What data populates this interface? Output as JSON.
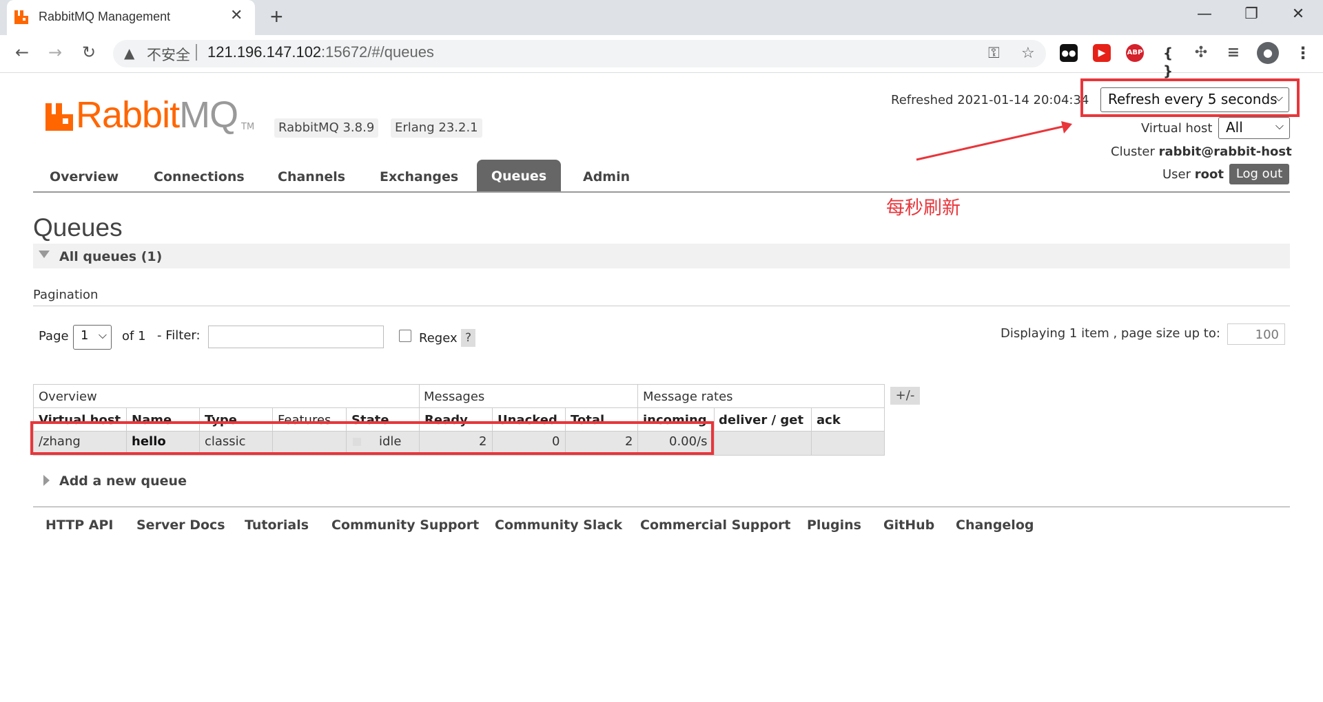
{
  "browser": {
    "tab_title": "RabbitMQ Management",
    "tab_close": "✕",
    "new_tab": "+",
    "window_controls": [
      "—",
      "❐",
      "✕"
    ],
    "nav": {
      "back": "←",
      "forward": "→",
      "reload": "↻"
    },
    "security_label": "不安全",
    "url_host": "121.196.147.102",
    "url_rest": ":15672/#/queues",
    "omnibox_icons": [
      "key-icon",
      "star-icon"
    ],
    "extensions": [
      {
        "name": "tampermonkey-extension-icon",
        "color": "#000000",
        "glyph": "●●"
      },
      {
        "name": "youtube-extension-icon",
        "color": "#e62117",
        "glyph": "▶"
      },
      {
        "name": "adblock-plus-extension-icon",
        "color": "#d4212b",
        "glyph": "ABP"
      },
      {
        "name": "json-extension-icon",
        "color": "#ffffff",
        "glyph": "{ }"
      },
      {
        "name": "puzzle-extensions-icon",
        "color": "#ffffff",
        "glyph": "✣"
      },
      {
        "name": "media-queue-icon",
        "color": "#ffffff",
        "glyph": "≡"
      },
      {
        "name": "profile-avatar-icon",
        "color": "#ffffff",
        "glyph": "●"
      },
      {
        "name": "menu-kebab-icon",
        "color": "#ffffff",
        "glyph": "⋮"
      }
    ]
  },
  "colors": {
    "brand": "#ff6600",
    "tab_active": "#666666",
    "annotation": "#e8363b"
  },
  "header": {
    "logo_rabbit": "Rabbit",
    "logo_mq": "MQ",
    "logo_tm": "TM",
    "rabbitmq_version": "RabbitMQ 3.8.9",
    "erlang_version": "Erlang 23.2.1",
    "refreshed": "Refreshed 2021-01-14 20:04:34",
    "refresh_select": "Refresh every 5 seconds",
    "vhost_label": "Virtual host",
    "vhost_select": "All",
    "cluster_label": "Cluster",
    "cluster_name": "rabbit@rabbit-host",
    "user_label": "User",
    "user_name": "root",
    "logout": "Log out"
  },
  "nav_tabs": [
    "Overview",
    "Connections",
    "Channels",
    "Exchanges",
    "Queues",
    "Admin"
  ],
  "annotation_text": "每秒刷新",
  "main": {
    "title": "Queues",
    "all_queues": "All queues (1)",
    "pagination_title": "Pagination",
    "page_label": "Page",
    "page_value": "1",
    "of_label": "of 1",
    "filter_label": "- Filter:",
    "filter_value": "",
    "regex_label": "Regex",
    "help": "?",
    "displaying": "Displaying 1 item , page size up to:",
    "page_size": "100",
    "plus_minus": "+/-",
    "add_queue": "Add a new queue"
  },
  "table": {
    "groups": [
      "Overview",
      "Messages",
      "Message rates"
    ],
    "headers": [
      "Virtual host",
      "Name",
      "Type",
      "Features",
      "State",
      "Ready",
      "Unacked",
      "Total",
      "incoming",
      "deliver / get",
      "ack"
    ],
    "rows": [
      {
        "vhost": "/zhang",
        "name": "hello",
        "type": "classic",
        "features": "",
        "state": "idle",
        "ready": "2",
        "unacked": "0",
        "total": "2",
        "incoming": "0.00/s",
        "deliver_get": "",
        "ack": ""
      }
    ]
  },
  "footer": [
    "HTTP API",
    "Server Docs",
    "Tutorials",
    "Community Support",
    "Community Slack",
    "Commercial Support",
    "Plugins",
    "GitHub",
    "Changelog"
  ]
}
